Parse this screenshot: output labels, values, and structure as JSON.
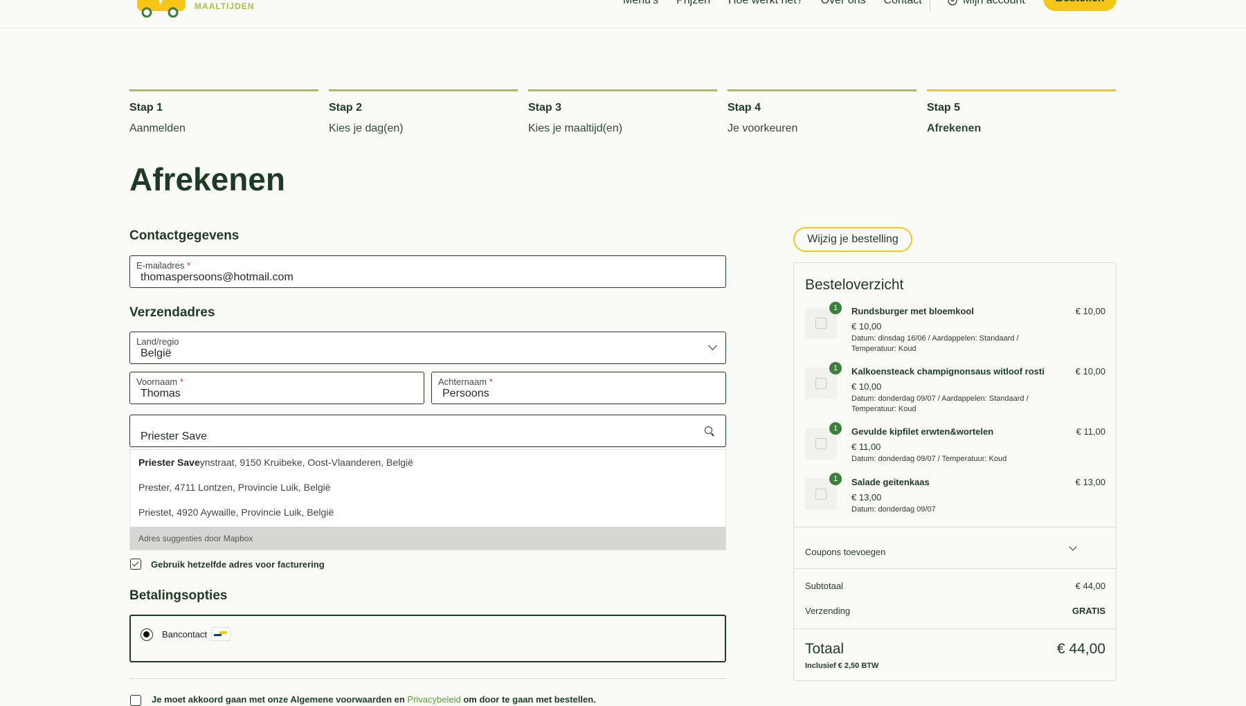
{
  "brand": {
    "logo_text": "MAALTIJDEN",
    "accent": "#f5c518",
    "green": "#a7c04a",
    "dark": "#1d3b25"
  },
  "nav": {
    "items": [
      "Menu's",
      "Prijzen",
      "Hoe werkt het?",
      "Over ons",
      "Contact"
    ],
    "account": "Mijn account",
    "order": "Bestellen"
  },
  "steps": [
    {
      "num": "Stap 1",
      "label": "Aanmelden"
    },
    {
      "num": "Stap 2",
      "label": "Kies je dag(en)"
    },
    {
      "num": "Stap 3",
      "label": "Kies je maaltijd(en)"
    },
    {
      "num": "Stap 4",
      "label": "Je voorkeuren"
    },
    {
      "num": "Stap 5",
      "label": "Afrekenen"
    }
  ],
  "page_title": "Afrekenen",
  "contact": {
    "title": "Contactgegevens",
    "email_label": "E-mailadres",
    "email_value": "thomaspersoons@hotmail.com"
  },
  "shipping": {
    "title": "Verzendadres",
    "country_label": "Land/regio",
    "country_value": "België",
    "firstname_label": "Voornaam",
    "firstname_value": "Thomas",
    "lastname_label": "Achternaam",
    "lastname_value": "Persoons",
    "address_value": "Priester Save",
    "required_mark": "*"
  },
  "suggestions": {
    "items": [
      {
        "bold": "Priester Save",
        "rest": "ynstraat, 9150 Kruibeke, Oost-Vlaanderen, België"
      },
      {
        "bold": "",
        "rest": "Prester, 4711 Lontzen, Provincie Luik, België"
      },
      {
        "bold": "",
        "rest": "Priestet, 4920 Aywaille, Provincie Luik, België"
      }
    ],
    "footer": "Adres suggesties door Mapbox"
  },
  "billing_same": {
    "label": "Gebruik hetzelfde adres voor facturering",
    "checked": true
  },
  "payment": {
    "title": "Betalingsopties",
    "method": "Bancontact"
  },
  "terms": {
    "prefix": "Je moet akkoord gaan met onze Algemene voorwaarden en ",
    "link": "Privacybeleid",
    "suffix": " om door te gaan met bestellen."
  },
  "summary": {
    "edit_button": "Wijzig je bestelling",
    "title": "Besteloverzicht",
    "items": [
      {
        "qty": "1",
        "name": "Rundsburger met bloemkool",
        "price": "€ 10,00",
        "line_price": "€ 10,00",
        "meta": "Datum: dinsdag 16/06 / Aardappelen: Standaard / Temperatuur: Koud"
      },
      {
        "qty": "1",
        "name": "Kalkoensteack champignonsaus witloof rosti",
        "price": "€ 10,00",
        "line_price": "€ 10,00",
        "meta": "Datum: donderdag 09/07 / Aardappelen: Standaard / Temperatuur: Koud"
      },
      {
        "qty": "1",
        "name": "Gevulde kipfilet erwten&wortelen",
        "price": "€ 11,00",
        "line_price": "€ 11,00",
        "meta": "Datum: donderdag 09/07 / Temperatuur: Koud"
      },
      {
        "qty": "1",
        "name": "Salade geitenkaas",
        "price": "€ 13,00",
        "line_price": "€ 13,00",
        "meta": "Datum: donderdag 09/07"
      }
    ],
    "coupons": "Coupons toevoegen",
    "subtotal_label": "Subtotaal",
    "subtotal_value": "€ 44,00",
    "shipping_label": "Verzending",
    "shipping_value": "GRATIS",
    "total_label": "Totaal",
    "total_value": "€ 44,00",
    "tax_note": "Inclusief € 2,50 BTW"
  }
}
